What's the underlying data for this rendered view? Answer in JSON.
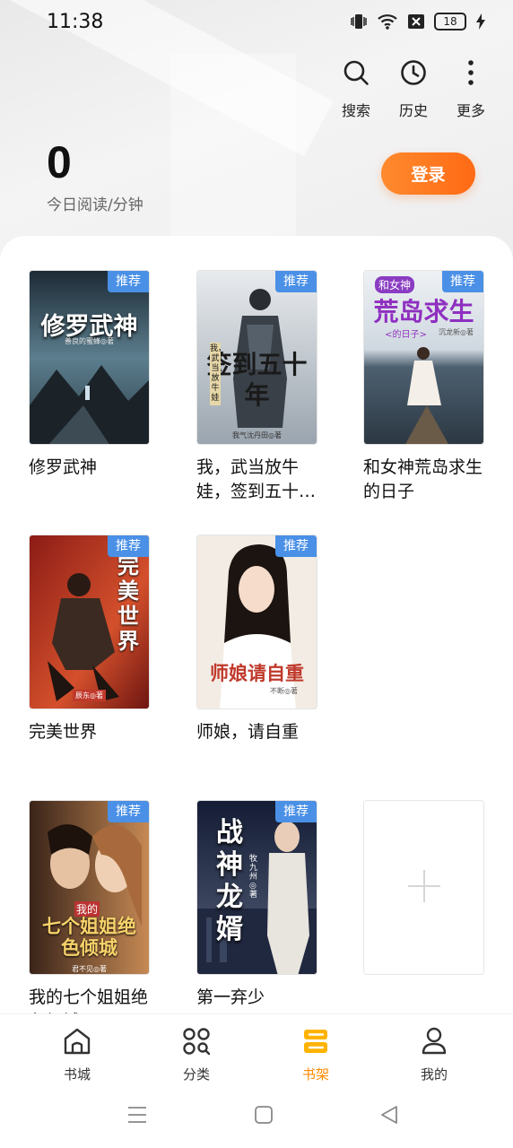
{
  "status_bar": {
    "time": "11:38",
    "battery": "18"
  },
  "top_actions": [
    {
      "label": "搜索",
      "icon": "search-icon"
    },
    {
      "label": "历史",
      "icon": "clock-icon"
    },
    {
      "label": "更多",
      "icon": "more-vertical-icon"
    }
  ],
  "reading": {
    "count": "0",
    "label": "今日阅读/分钟"
  },
  "login_label": "登录",
  "badge_label": "推荐",
  "books": [
    {
      "title": "修罗武神",
      "cover_title": "修罗武神",
      "cover_author": "善良的蜜蜂◎著",
      "colors": [
        "#1d2b36",
        "#5c7e8e"
      ]
    },
    {
      "title": "我，武当放牛娃，签到五十…",
      "cover_title": "签到五十年",
      "cover_side": "我，武当放牛娃",
      "cover_author": "我气沈丹田◎著",
      "colors": [
        "#dfe3e8",
        "#8d98a4"
      ]
    },
    {
      "title": "和女神荒岛求生的日子",
      "cover_title": "荒岛求生",
      "cover_top": "和女神",
      "cover_sub": "<的日子>",
      "cover_author": "沉龙新◎著",
      "colors": [
        "#d9dfe6",
        "#3b4b5a"
      ]
    },
    {
      "title": "完美世界",
      "cover_title": "完美世界",
      "cover_author": "辰东◎著",
      "colors": [
        "#7b1814",
        "#c9492a"
      ]
    },
    {
      "title": "师娘，请自重",
      "cover_title": "师娘请自重",
      "cover_author": "不断◎著",
      "colors": [
        "#f6efe7",
        "#d9c6b4"
      ]
    },
    {
      "title": "我的七个姐姐绝色倾城",
      "cover_title": "七个姐姐绝色倾城",
      "cover_top": "我的",
      "cover_author": "君不见◎著",
      "colors": [
        "#3a2419",
        "#c88b55"
      ]
    },
    {
      "title": "第一弃少",
      "cover_title": "战神龙婿",
      "cover_author": "牧九州◎著",
      "colors": [
        "#141d35",
        "#56607a"
      ]
    }
  ],
  "bottom_nav": [
    {
      "label": "书城",
      "icon": "home-icon",
      "active": false
    },
    {
      "label": "分类",
      "icon": "category-icon",
      "active": false
    },
    {
      "label": "书架",
      "icon": "bookshelf-icon",
      "active": true
    },
    {
      "label": "我的",
      "icon": "profile-icon",
      "active": false
    }
  ],
  "system_nav": [
    "menu-icon",
    "home-square-icon",
    "back-triangle-icon"
  ]
}
